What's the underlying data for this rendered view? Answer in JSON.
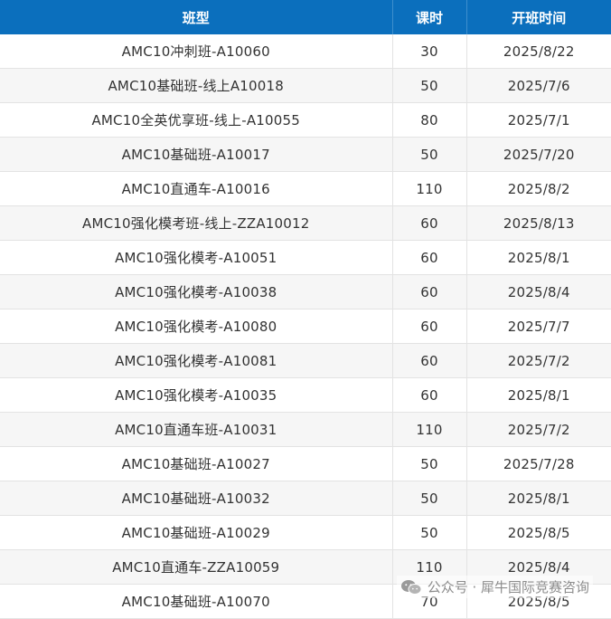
{
  "table": {
    "headers": [
      "班型",
      "课时",
      "开班时间"
    ],
    "rows": [
      {
        "name": "AMC10冲刺班-A10060",
        "hours": "30",
        "date": "2025/8/22"
      },
      {
        "name": "AMC10基础班-线上A10018",
        "hours": "50",
        "date": "2025/7/6"
      },
      {
        "name": "AMC10全英优享班-线上-A10055",
        "hours": "80",
        "date": "2025/7/1"
      },
      {
        "name": "AMC10基础班-A10017",
        "hours": "50",
        "date": "2025/7/20"
      },
      {
        "name": "AMC10直通车-A10016",
        "hours": "110",
        "date": "2025/8/2"
      },
      {
        "name": "AMC10强化模考班-线上-ZZA10012",
        "hours": "60",
        "date": "2025/8/13"
      },
      {
        "name": "AMC10强化模考-A10051",
        "hours": "60",
        "date": "2025/8/1"
      },
      {
        "name": "AMC10强化模考-A10038",
        "hours": "60",
        "date": "2025/8/4"
      },
      {
        "name": "AMC10强化模考-A10080",
        "hours": "60",
        "date": "2025/7/7"
      },
      {
        "name": "AMC10强化模考-A10081",
        "hours": "60",
        "date": "2025/7/2"
      },
      {
        "name": "AMC10强化模考-A10035",
        "hours": "60",
        "date": "2025/8/1"
      },
      {
        "name": "AMC10直通车班-A10031",
        "hours": "110",
        "date": "2025/7/2"
      },
      {
        "name": "AMC10基础班-A10027",
        "hours": "50",
        "date": "2025/7/28"
      },
      {
        "name": "AMC10基础班-A10032",
        "hours": "50",
        "date": "2025/8/1"
      },
      {
        "name": "AMC10基础班-A10029",
        "hours": "50",
        "date": "2025/8/5"
      },
      {
        "name": "AMC10直通车-ZZA10059",
        "hours": "110",
        "date": "2025/8/4"
      },
      {
        "name": "AMC10基础班-A10070",
        "hours": "70",
        "date": "2025/8/5"
      }
    ]
  },
  "watermark": {
    "text": "公众号 · 犀牛国际竞赛咨询",
    "icon": "wechat-icon"
  },
  "colors": {
    "header_bg": "#0b6fbd",
    "header_text": "#ffffff",
    "stripe": "#f6f6f6",
    "text": "#333333"
  }
}
